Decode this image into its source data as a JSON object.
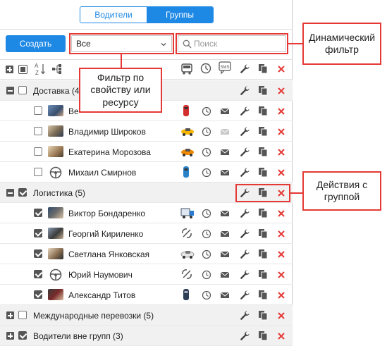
{
  "tabs": [
    {
      "label": "Водители",
      "active": false
    },
    {
      "label": "Группы",
      "active": true
    }
  ],
  "toolbar": {
    "create_label": "Создать",
    "filter_value": "Все",
    "search_placeholder": "Поиск"
  },
  "header_icons": [
    "expand-all-icon",
    "collapse-all-icon",
    "sort-az-icon",
    "tree-icon",
    "vehicle-icon",
    "clock-icon",
    "sms-icon",
    "wrench-icon",
    "copy-icon",
    "delete-icon"
  ],
  "groups": [
    {
      "name": "Доставка (4)",
      "expanded": true,
      "checked": false,
      "items": [
        {
          "name": "Ве",
          "checked": false,
          "photo": "photo",
          "vehicle": "red-car",
          "sms_enabled": true
        },
        {
          "name": "Владимир Широков",
          "checked": false,
          "photo": "photo",
          "vehicle": "yellow-car",
          "sms_enabled": false
        },
        {
          "name": "Екатерина Морозова",
          "checked": false,
          "photo": "photo",
          "vehicle": "orange-car",
          "sms_enabled": true
        },
        {
          "name": "Михаил Смирнов",
          "checked": false,
          "photo": "wheel",
          "vehicle": "blue-car",
          "sms_enabled": true
        }
      ]
    },
    {
      "name": "Логистика (5)",
      "expanded": true,
      "checked": true,
      "items": [
        {
          "name": "Виктор Бондаренко",
          "checked": true,
          "photo": "photo",
          "vehicle": "truck",
          "sms_enabled": true
        },
        {
          "name": "Георгий Кириленко",
          "checked": true,
          "photo": "photo",
          "vehicle": "unassign",
          "sms_enabled": true
        },
        {
          "name": "Светлана Янковская",
          "checked": true,
          "photo": "photo",
          "vehicle": "white-car",
          "sms_enabled": true
        },
        {
          "name": "Юрий Наумович",
          "checked": true,
          "photo": "wheel",
          "vehicle": "unassign",
          "sms_enabled": true
        },
        {
          "name": "Александр Титов",
          "checked": true,
          "photo": "photo",
          "vehicle": "dark-car",
          "sms_enabled": true
        }
      ]
    },
    {
      "name": "Международные перевозки (5)",
      "expanded": false,
      "checked": false,
      "items": []
    },
    {
      "name": "Водители вне групп (3)",
      "expanded": false,
      "checked": true,
      "items": []
    }
  ],
  "callouts": {
    "dynamic_filter": "Динамический фильтр",
    "property_filter": "Фильтр по свойству или ресурсу",
    "group_actions": "Действия с группой"
  },
  "colors": {
    "accent": "#1e88e5",
    "delete": "#e53935",
    "callout_border": "#e53935",
    "group_bg": "#f1f1f1"
  }
}
